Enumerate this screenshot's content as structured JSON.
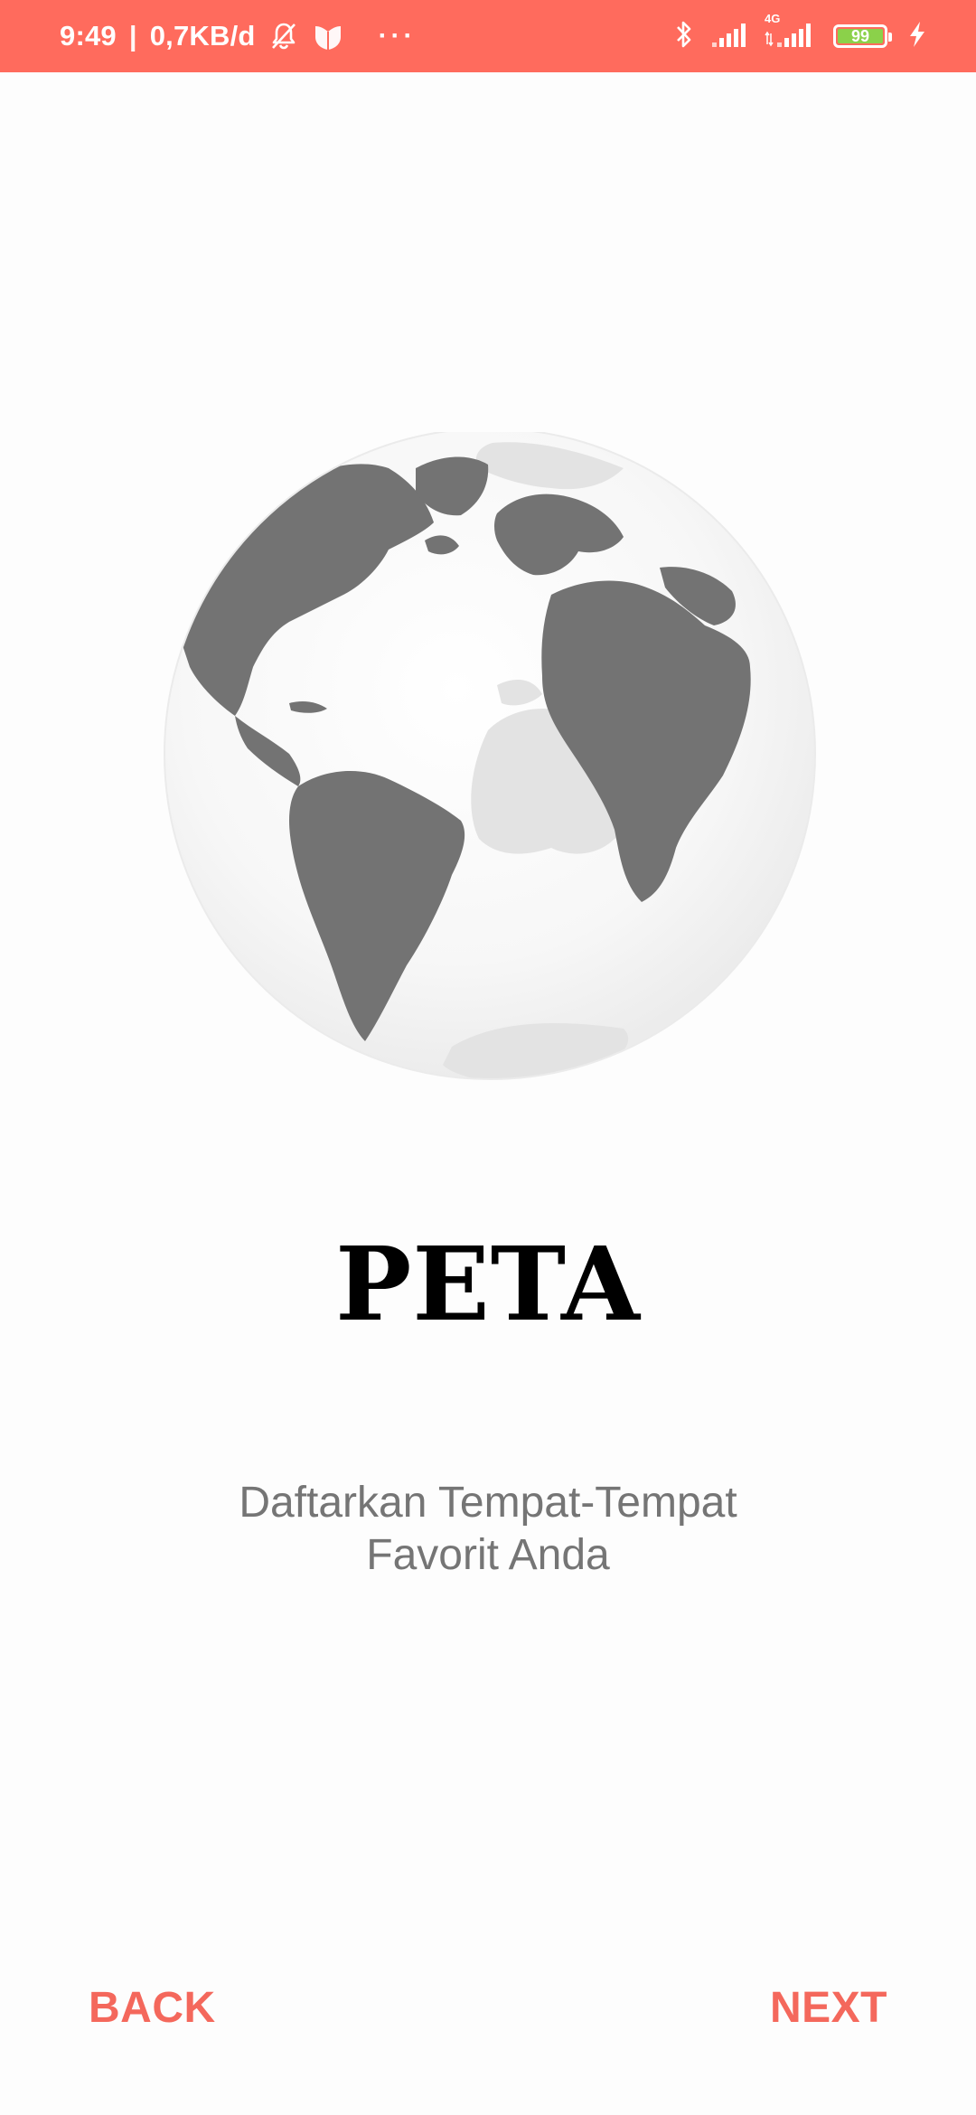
{
  "status_bar": {
    "time": "9:49",
    "separator": "|",
    "network_speed": "0,7KB/d",
    "more": "···",
    "network_type": "4G",
    "battery_level": "99",
    "battery_fraction": 0.99,
    "background_color": "#ff6b5d",
    "icons": [
      "mute-icon",
      "shield-app-icon",
      "bluetooth-icon",
      "signal-icon",
      "signal-4g-icon",
      "battery-icon",
      "charging-icon"
    ]
  },
  "onboarding": {
    "illustration": "globe-icon",
    "title": "PETA",
    "subtitle_line1": "Daftarkan Tempat-Tempat",
    "subtitle_line2": "Favorit Anda"
  },
  "navigation": {
    "back_label": "BACK",
    "next_label": "NEXT",
    "accent_color": "#f4685c"
  }
}
